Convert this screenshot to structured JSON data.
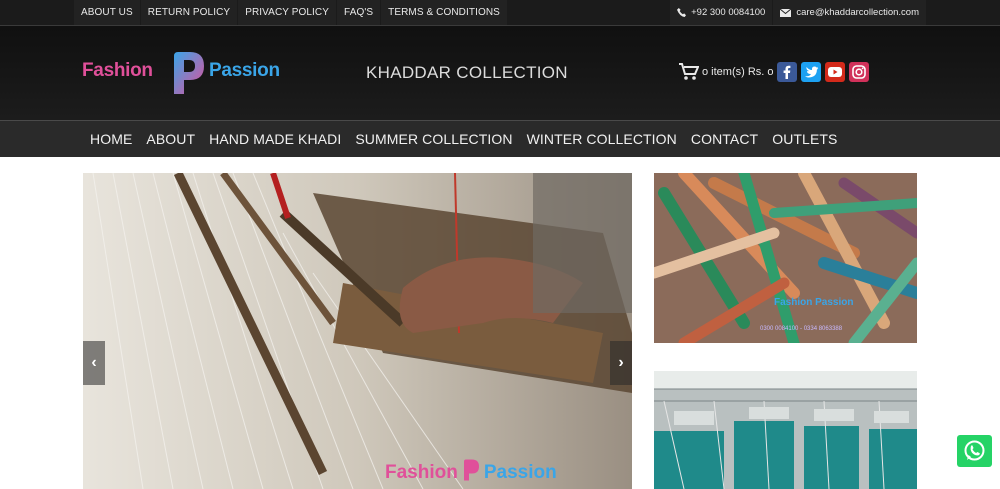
{
  "topbar": {
    "links": [
      "ABOUT US",
      "RETURN POLICY",
      "PRIVACY POLICY",
      "FAQ'S",
      "TERMS & CONDITIONS"
    ],
    "phone": "+92 300 0084100",
    "email": "care@khaddarcollection.com"
  },
  "header": {
    "logo_text_1": "Fashion",
    "logo_text_2": "Passion",
    "site_title": "KHADDAR COLLECTION",
    "cart_text": "o item(s) Rs. o",
    "social": [
      "facebook-icon",
      "twitter-icon",
      "youtube-icon",
      "instagram-icon"
    ]
  },
  "nav": {
    "items": [
      "HOME",
      "ABOUT",
      "HAND MADE KHADI",
      "SUMMER COLLECTION",
      "WINTER COLLECTION",
      "CONTACT",
      "OUTLETS"
    ]
  },
  "slider": {
    "watermark_1": "Fashion",
    "watermark_2": "Passion",
    "prev": "‹",
    "next": "›"
  },
  "side_banner": {
    "watermark": "Fashion Passion",
    "phones": "0300 0084100 - 0334 8063388"
  },
  "colors": {
    "pink": "#e0509a",
    "blue": "#3aa5e8",
    "dark": "#1b1b1b",
    "whatsapp": "#25d366"
  }
}
